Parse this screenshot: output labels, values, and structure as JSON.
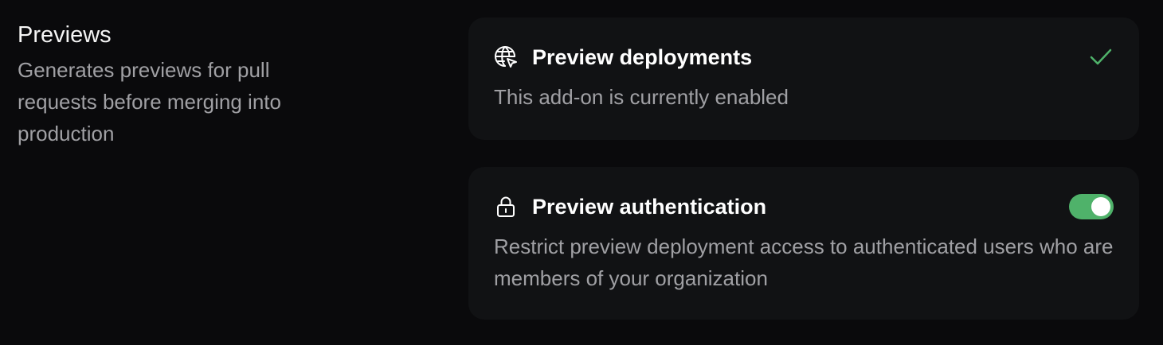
{
  "section": {
    "title": "Previews",
    "description": "Generates previews for pull requests before merging into production"
  },
  "cards": [
    {
      "title": "Preview deployments",
      "description": "This add-on is currently enabled",
      "icon": "globe-cursor-icon",
      "status_icon": "check-icon",
      "status_color": "#4fb26a"
    },
    {
      "title": "Preview authentication",
      "description": "Restrict preview deployment access to authenticated users who are members of your organization",
      "icon": "lock-icon",
      "toggle_on": true,
      "toggle_color": "#4fb26a"
    }
  ]
}
